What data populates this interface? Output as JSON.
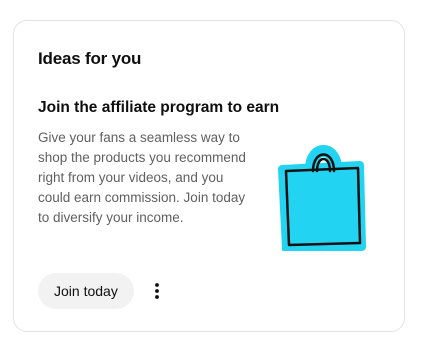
{
  "card": {
    "title": "Ideas for you",
    "promo": {
      "heading": "Join the affiliate program to earn",
      "body": "Give your fans a seamless way to shop the products you recommend right from your videos, and you could earn commission. Join today to diversify your income.",
      "illustration_icon": "shopping-bag-icon",
      "illustration_color": "#22d3f2"
    },
    "actions": {
      "join_label": "Join today",
      "more_icon": "more-vert-icon"
    }
  }
}
